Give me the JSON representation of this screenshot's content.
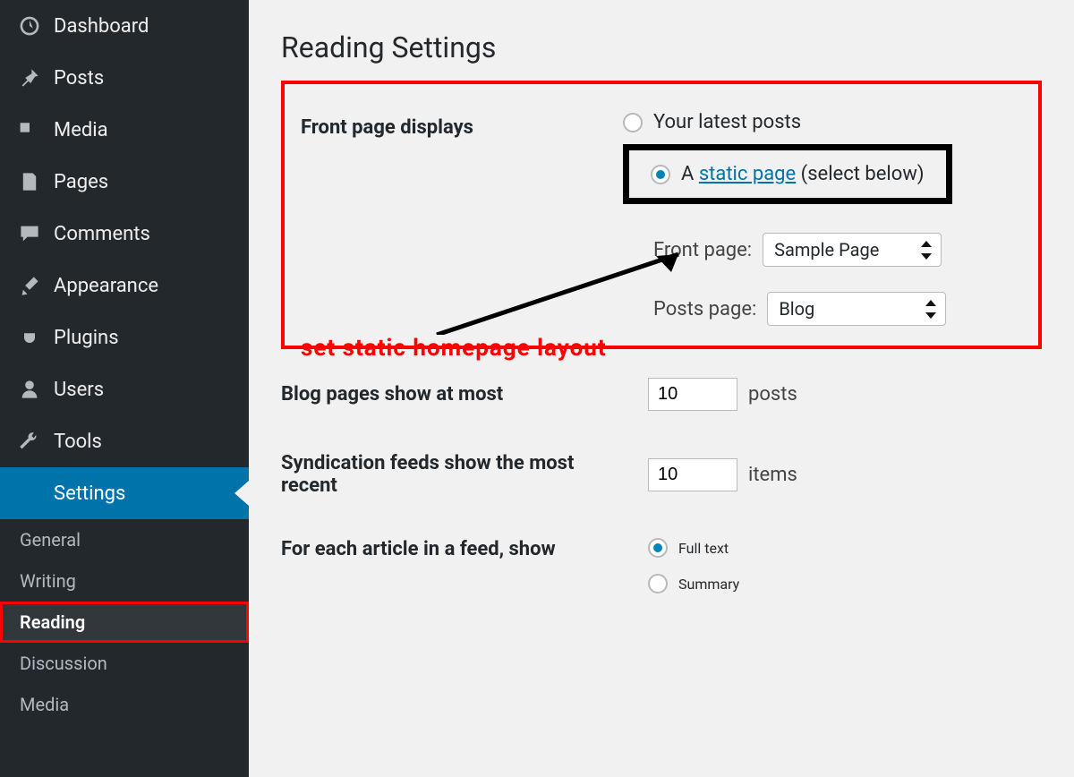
{
  "sidebar": {
    "items": [
      {
        "id": "dashboard",
        "label": "Dashboard"
      },
      {
        "id": "posts",
        "label": "Posts"
      },
      {
        "id": "media",
        "label": "Media"
      },
      {
        "id": "pages",
        "label": "Pages"
      },
      {
        "id": "comments",
        "label": "Comments"
      },
      {
        "id": "appearance",
        "label": "Appearance"
      },
      {
        "id": "plugins",
        "label": "Plugins"
      },
      {
        "id": "users",
        "label": "Users"
      },
      {
        "id": "tools",
        "label": "Tools"
      },
      {
        "id": "settings",
        "label": "Settings"
      }
    ],
    "settings_sub": [
      {
        "id": "general",
        "label": "General"
      },
      {
        "id": "writing",
        "label": "Writing"
      },
      {
        "id": "reading",
        "label": "Reading"
      },
      {
        "id": "discussion",
        "label": "Discussion"
      },
      {
        "id": "media",
        "label": "Media"
      }
    ]
  },
  "page": {
    "title": "Reading Settings",
    "front_page_displays": {
      "label": "Front page displays",
      "opt_latest": "Your latest posts",
      "opt_static_prefix": "A ",
      "opt_static_link": "static page",
      "opt_static_suffix": " (select below)",
      "front_page_label": "Front page:",
      "front_page_value": "Sample Page",
      "posts_page_label": "Posts page:",
      "posts_page_value": "Blog"
    },
    "annotation": "set static homepage layout",
    "blog_pages": {
      "label": "Blog pages show at most",
      "value": "10",
      "suffix": "posts"
    },
    "syndication": {
      "label": "Syndication feeds show the most recent",
      "value": "10",
      "suffix": "items"
    },
    "article_feed": {
      "label": "For each article in a feed, show",
      "opt_full": "Full text",
      "opt_summary": "Summary"
    }
  }
}
